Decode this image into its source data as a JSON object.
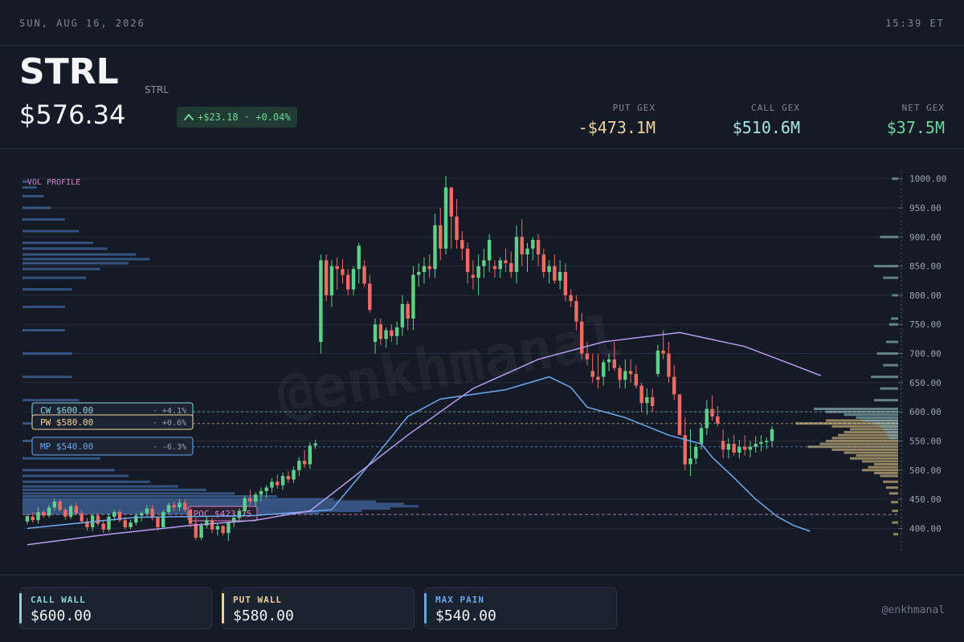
{
  "header": {
    "date": "SUN, AUG 16, 2026",
    "time": "15:39 ET",
    "ticker": "STRL",
    "subticker": "STRL",
    "price": "$576.34",
    "change": "+$23.18 · +0.04%",
    "change_icon": "chevron-up-icon"
  },
  "gex": {
    "put_label": "PUT GEX",
    "put_value": "-$473.1M",
    "call_label": "CALL GEX",
    "call_value": "$510.6M",
    "net_label": "NET GEX",
    "net_value": "$37.5M"
  },
  "footer": {
    "call_wall_label": "CALL WALL",
    "call_wall_value": "$600.00",
    "put_wall_label": "PUT WALL",
    "put_wall_value": "$580.00",
    "max_pain_label": "MAX PAIN",
    "max_pain_value": "$540.00",
    "handle": "@enkhmanal"
  },
  "colors": {
    "up": "#5fd08b",
    "down": "#ef6b63",
    "call": "#8ed4d6",
    "put": "#efd39b",
    "maxpain": "#6ea3ee",
    "poc": "#d984c8",
    "ma_fast": "#6ea8ee",
    "ma_slow": "#b89cf0"
  },
  "chart_data": {
    "type": "candlestick",
    "title": "",
    "watermark": "@enkhmanal",
    "volume_profile_label": "VOL PROFILE",
    "ylim": [
      362,
      1004
    ],
    "yticks": [
      400,
      450,
      500,
      550,
      600,
      650,
      700,
      750,
      800,
      850,
      900,
      950,
      1000
    ],
    "ytick_labels": [
      "400.00",
      "450.00",
      "500.00",
      "550.00",
      "600.00",
      "650.00",
      "700.00",
      "750.00",
      "800.00",
      "850.00",
      "900.00",
      "950.00",
      "1000.00"
    ],
    "levels": [
      {
        "key": "cw",
        "label": "CW $600.00",
        "pct": "· +4.1%",
        "price": 600
      },
      {
        "key": "pw",
        "label": "PW $580.00",
        "pct": "· +0.6%",
        "price": 580
      },
      {
        "key": "mp",
        "label": "MP $540.00",
        "pct": "· -6.3%",
        "price": 540
      }
    ],
    "poc": {
      "label": "POC $423.75",
      "price": 423.75
    },
    "candles": [
      [
        412,
        425,
        407,
        421
      ],
      [
        420,
        428,
        410,
        414
      ],
      [
        414,
        436,
        408,
        428
      ],
      [
        428,
        432,
        418,
        422
      ],
      [
        422,
        440,
        418,
        436
      ],
      [
        436,
        452,
        430,
        446
      ],
      [
        446,
        450,
        428,
        432
      ],
      [
        432,
        436,
        415,
        420
      ],
      [
        420,
        441,
        416,
        438
      ],
      [
        438,
        444,
        422,
        426
      ],
      [
        426,
        432,
        408,
        412
      ],
      [
        412,
        418,
        396,
        402
      ],
      [
        402,
        425,
        395,
        422
      ],
      [
        422,
        426,
        404,
        408
      ],
      [
        408,
        415,
        392,
        398
      ],
      [
        398,
        425,
        394,
        420
      ],
      [
        420,
        432,
        412,
        428
      ],
      [
        428,
        432,
        410,
        414
      ],
      [
        414,
        420,
        398,
        402
      ],
      [
        402,
        415,
        398,
        410
      ],
      [
        410,
        426,
        405,
        422
      ],
      [
        422,
        430,
        412,
        426
      ],
      [
        426,
        440,
        420,
        434
      ],
      [
        434,
        440,
        414,
        418
      ],
      [
        418,
        420,
        396,
        402
      ],
      [
        402,
        432,
        400,
        428
      ],
      [
        428,
        444,
        424,
        440
      ],
      [
        440,
        446,
        430,
        436
      ],
      [
        436,
        450,
        430,
        444
      ],
      [
        444,
        450,
        428,
        432
      ],
      [
        432,
        436,
        402,
        408
      ],
      [
        408,
        418,
        380,
        384
      ],
      [
        384,
        410,
        380,
        405
      ],
      [
        405,
        420,
        400,
        414
      ],
      [
        414,
        418,
        392,
        398
      ],
      [
        398,
        408,
        388,
        404
      ],
      [
        404,
        406,
        388,
        392
      ],
      [
        392,
        412,
        378,
        410
      ],
      [
        410,
        424,
        402,
        418
      ],
      [
        418,
        434,
        412,
        430
      ],
      [
        430,
        456,
        424,
        452
      ],
      [
        452,
        466,
        440,
        446
      ],
      [
        446,
        462,
        438,
        458
      ],
      [
        458,
        470,
        446,
        464
      ],
      [
        464,
        474,
        452,
        470
      ],
      [
        470,
        486,
        462,
        480
      ],
      [
        480,
        492,
        468,
        474
      ],
      [
        474,
        496,
        466,
        490
      ],
      [
        490,
        498,
        478,
        484
      ],
      [
        484,
        506,
        478,
        500
      ],
      [
        500,
        522,
        490,
        516
      ],
      [
        516,
        534,
        504,
        510
      ],
      [
        510,
        548,
        502,
        542
      ],
      [
        542,
        552,
        536,
        546
      ],
      [
        720,
        870,
        700,
        860
      ],
      [
        860,
        870,
        790,
        800
      ],
      [
        800,
        860,
        780,
        850
      ],
      [
        850,
        865,
        810,
        845
      ],
      [
        845,
        862,
        820,
        835
      ],
      [
        835,
        845,
        800,
        810
      ],
      [
        810,
        850,
        800,
        845
      ],
      [
        845,
        890,
        820,
        885
      ],
      [
        850,
        860,
        815,
        820
      ],
      [
        820,
        835,
        770,
        775
      ],
      [
        720,
        760,
        700,
        750
      ],
      [
        750,
        760,
        715,
        725
      ],
      [
        725,
        745,
        710,
        740
      ],
      [
        740,
        750,
        720,
        730
      ],
      [
        730,
        755,
        715,
        745
      ],
      [
        745,
        800,
        730,
        785
      ],
      [
        785,
        790,
        740,
        760
      ],
      [
        760,
        850,
        740,
        835
      ],
      [
        835,
        855,
        815,
        840
      ],
      [
        840,
        865,
        820,
        850
      ],
      [
        850,
        870,
        830,
        845
      ],
      [
        845,
        940,
        830,
        920
      ],
      [
        920,
        950,
        860,
        880
      ],
      [
        880,
        1005,
        870,
        985
      ],
      [
        985,
        975,
        880,
        935
      ],
      [
        935,
        965,
        880,
        895
      ],
      [
        895,
        910,
        860,
        880
      ],
      [
        880,
        890,
        820,
        840
      ],
      [
        835,
        860,
        810,
        830
      ],
      [
        830,
        870,
        800,
        850
      ],
      [
        850,
        880,
        830,
        860
      ],
      [
        860,
        905,
        840,
        895
      ],
      [
        850,
        860,
        830,
        845
      ],
      [
        845,
        865,
        830,
        860
      ],
      [
        860,
        880,
        840,
        855
      ],
      [
        855,
        875,
        830,
        840
      ],
      [
        840,
        920,
        820,
        900
      ],
      [
        900,
        930,
        850,
        870
      ],
      [
        870,
        890,
        840,
        880
      ],
      [
        880,
        900,
        860,
        895
      ],
      [
        895,
        905,
        850,
        870
      ],
      [
        870,
        880,
        830,
        840
      ],
      [
        840,
        860,
        820,
        850
      ],
      [
        850,
        870,
        820,
        825
      ],
      [
        825,
        860,
        810,
        840
      ],
      [
        840,
        855,
        790,
        800
      ],
      [
        800,
        810,
        780,
        790
      ],
      [
        790,
        800,
        740,
        755
      ],
      [
        755,
        770,
        690,
        700
      ],
      [
        700,
        720,
        680,
        690
      ],
      [
        670,
        700,
        650,
        660
      ],
      [
        660,
        700,
        640,
        655
      ],
      [
        660,
        690,
        645,
        685
      ],
      [
        685,
        700,
        670,
        690
      ],
      [
        690,
        720,
        670,
        675
      ],
      [
        675,
        680,
        640,
        655
      ],
      [
        655,
        690,
        640,
        670
      ],
      [
        670,
        690,
        650,
        665
      ],
      [
        665,
        680,
        640,
        645
      ],
      [
        645,
        650,
        600,
        615
      ],
      [
        615,
        640,
        595,
        625
      ],
      [
        625,
        640,
        600,
        610
      ],
      [
        665,
        715,
        660,
        705
      ],
      [
        705,
        740,
        690,
        700
      ],
      [
        700,
        720,
        650,
        660
      ],
      [
        660,
        680,
        620,
        630
      ],
      [
        630,
        620,
        575,
        560
      ],
      [
        560,
        590,
        500,
        510
      ],
      [
        510,
        570,
        490,
        520
      ],
      [
        520,
        545,
        510,
        540
      ],
      [
        545,
        580,
        535,
        572
      ],
      [
        572,
        620,
        560,
        605
      ],
      [
        605,
        628,
        585,
        592
      ],
      [
        592,
        610,
        575,
        580
      ],
      [
        550,
        570,
        520,
        535
      ],
      [
        535,
        555,
        520,
        545
      ],
      [
        545,
        560,
        525,
        530
      ],
      [
        530,
        552,
        520,
        540
      ],
      [
        540,
        560,
        525,
        535
      ],
      [
        535,
        550,
        522,
        540
      ],
      [
        540,
        558,
        530,
        545
      ],
      [
        545,
        560,
        532,
        548
      ],
      [
        548,
        556,
        536,
        550
      ],
      [
        550,
        575,
        540,
        570
      ]
    ],
    "ma_fast": [
      [
        0,
        400
      ],
      [
        20,
        419
      ],
      [
        42,
        422
      ],
      [
        56,
        432
      ],
      [
        61,
        488
      ],
      [
        70,
        592
      ],
      [
        76,
        622
      ],
      [
        88,
        638
      ],
      [
        96,
        660
      ],
      [
        100,
        642
      ],
      [
        103,
        608
      ],
      [
        110,
        590
      ],
      [
        118,
        560
      ],
      [
        124,
        545
      ],
      [
        126,
        522
      ],
      [
        130,
        487
      ],
      [
        134,
        450
      ],
      [
        138,
        420
      ],
      [
        141,
        405
      ],
      [
        144,
        395
      ]
    ],
    "ma_slow": [
      [
        0,
        372
      ],
      [
        15,
        390
      ],
      [
        30,
        405
      ],
      [
        42,
        414
      ],
      [
        52,
        430
      ],
      [
        60,
        488
      ],
      [
        70,
        560
      ],
      [
        82,
        640
      ],
      [
        94,
        690
      ],
      [
        106,
        720
      ],
      [
        120,
        736
      ],
      [
        132,
        712
      ],
      [
        141,
        680
      ],
      [
        146,
        662
      ]
    ],
    "volume_profile": {
      "left": [
        [
          426,
          420
        ],
        [
          430,
          480
        ],
        [
          434,
          520
        ],
        [
          438,
          560
        ],
        [
          442,
          540
        ],
        [
          446,
          500
        ],
        [
          450,
          440
        ],
        [
          455,
          360
        ],
        [
          460,
          300
        ],
        [
          466,
          260
        ],
        [
          472,
          220
        ],
        [
          480,
          180
        ],
        [
          490,
          150
        ],
        [
          500,
          130
        ],
        [
          520,
          110
        ],
        [
          550,
          100
        ],
        [
          580,
          90
        ],
        [
          620,
          80
        ],
        [
          660,
          70
        ],
        [
          700,
          70
        ],
        [
          740,
          60
        ],
        [
          780,
          60
        ],
        [
          810,
          70
        ],
        [
          830,
          90
        ],
        [
          845,
          110
        ],
        [
          855,
          150
        ],
        [
          862,
          180
        ],
        [
          870,
          160
        ],
        [
          880,
          120
        ],
        [
          890,
          100
        ],
        [
          910,
          80
        ],
        [
          930,
          60
        ],
        [
          950,
          40
        ],
        [
          970,
          30
        ],
        [
          985,
          20
        ],
        [
          995,
          10
        ]
      ],
      "right_put": [
        [
          590,
          0
        ],
        [
          585,
          120
        ],
        [
          580,
          170
        ],
        [
          575,
          110
        ],
        [
          570,
          80
        ],
        [
          565,
          90
        ],
        [
          560,
          100
        ],
        [
          555,
          110
        ],
        [
          550,
          120
        ],
        [
          545,
          130
        ],
        [
          540,
          150
        ],
        [
          535,
          110
        ],
        [
          530,
          90
        ],
        [
          525,
          70
        ],
        [
          520,
          80
        ],
        [
          515,
          60
        ],
        [
          510,
          40
        ],
        [
          505,
          50
        ],
        [
          500,
          60
        ],
        [
          495,
          40
        ],
        [
          490,
          30
        ],
        [
          480,
          25
        ],
        [
          470,
          20
        ],
        [
          460,
          15
        ],
        [
          445,
          12
        ],
        [
          430,
          10
        ],
        [
          410,
          10
        ],
        [
          390,
          8
        ]
      ],
      "right_call": [
        [
          605,
          140
        ],
        [
          600,
          120
        ],
        [
          595,
          90
        ],
        [
          590,
          70
        ],
        [
          585,
          60
        ],
        [
          580,
          40
        ],
        [
          575,
          30
        ],
        [
          570,
          25
        ],
        [
          565,
          20
        ],
        [
          560,
          18
        ],
        [
          555,
          15
        ],
        [
          620,
          40
        ],
        [
          640,
          30
        ],
        [
          660,
          45
        ],
        [
          680,
          25
        ],
        [
          700,
          35
        ],
        [
          720,
          20
        ],
        [
          750,
          15
        ],
        [
          760,
          12
        ],
        [
          800,
          10
        ],
        [
          830,
          25
        ],
        [
          850,
          40
        ],
        [
          900,
          30
        ],
        [
          1000,
          10
        ]
      ]
    }
  }
}
